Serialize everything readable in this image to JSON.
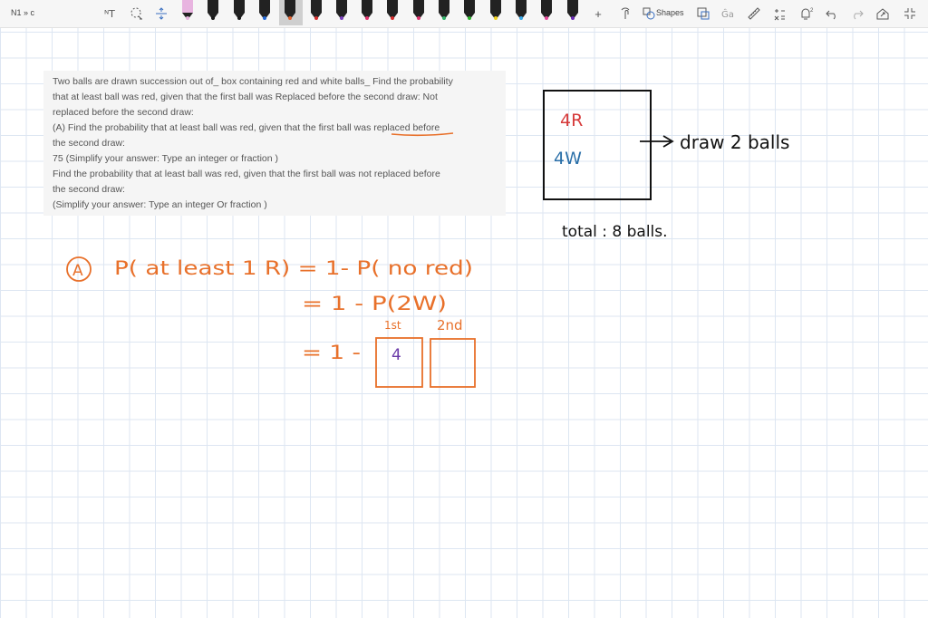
{
  "toolbar": {
    "page_name": "N1 » c",
    "shapes_label": "Shapes",
    "left_tools": [
      "text-select-icon",
      "lasso-icon",
      "insert-space-icon"
    ],
    "pens": [
      "#e8b4e0",
      "#1a1a1a",
      "#1a1a1a",
      "#2469d6",
      "#e0622f",
      "#d62d2d",
      "#7b3fbf",
      "#e0336e",
      "#d62d2d",
      "#e0336e",
      "#33b36b",
      "#2bb52b",
      "#f2d321",
      "#39a9e8",
      "#e8489b",
      "#6a2bb5"
    ],
    "right_tools": [
      "add-icon",
      "touch-drawing-icon",
      "shapes-icon",
      "ink-to-shape-icon",
      "ink-to-text-icon",
      "ruler-icon",
      "math-icon",
      "ink-replay-icon",
      "undo-icon",
      "redo-icon",
      "share-icon",
      "fullscreen-icon"
    ]
  },
  "question": {
    "lines": [
      "Two balls are drawn succession out of_ box containing red and white balls_ Find the probability",
      "that at least ball was red, given that the first ball was Replaced before the second draw: Not",
      "replaced before the second draw:",
      "(A) Find the probability that at least ball was red, given that the first ball was replaced before",
      "the second draw:",
      "75 (Simplify your answer: Type an integer or fraction )",
      "Find the probability that at least ball was red, given that the first ball was not replaced before",
      "the second draw:",
      "(Simplify your answer: Type an integer Or fraction )"
    ]
  },
  "notes": {
    "red_count": "4R",
    "white_count": "4W",
    "draw": "draw  2 balls",
    "total": "total : 8 balls.",
    "part_label": "A",
    "line1": "P( at least  1 R) = 1- P( no red)",
    "line2": "= 1  -  P(2W)",
    "first": "1st",
    "second": "2nd",
    "line3": "= 1  -",
    "box_value": "4"
  },
  "colors": {
    "ink_orange": "#e8702a",
    "ink_red": "#d63a3a",
    "ink_blue": "#2a6fa8",
    "ink_black": "#111111",
    "ink_purple": "#6a3aa8"
  }
}
